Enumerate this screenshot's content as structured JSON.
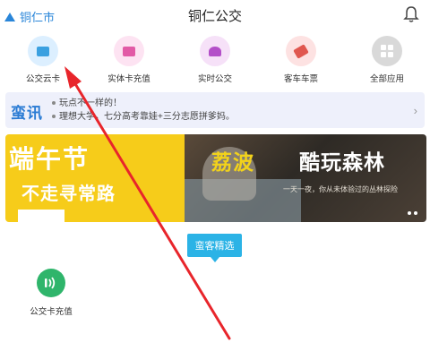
{
  "header": {
    "location": "铜仁市",
    "title": "铜仁公交"
  },
  "grid": [
    {
      "label": "公交云卡",
      "icon": "bus-card-icon",
      "bg": "#dcefff",
      "fg": "#3aa0e0"
    },
    {
      "label": "实体卡充值",
      "icon": "card-recharge-icon",
      "bg": "#fde3f2",
      "fg": "#e25aa6"
    },
    {
      "label": "实时公交",
      "icon": "realtime-bus-icon",
      "bg": "#f6e1f8",
      "fg": "#b34fc8"
    },
    {
      "label": "客车车票",
      "icon": "coach-ticket-icon",
      "bg": "#fde2e2",
      "fg": "#e0574f"
    },
    {
      "label": "全部应用",
      "icon": "all-apps-icon",
      "bg": "#e3e3e3",
      "fg": "#ffffff"
    }
  ],
  "news": {
    "logo": "蛮讯",
    "line1": "玩点不一样的！",
    "line2": "理想大学，七分高考靠娃+三分志愿拼爹妈。"
  },
  "banner": {
    "left_title": "端午节",
    "left_sub": "不走寻常路",
    "right_title_a": "荔波",
    "right_title_b": "酷玩森林",
    "right_sub": "一天一夜，你从未体验过的丛林探险"
  },
  "tabs": {
    "selected": "蛮客精选"
  },
  "service": {
    "label": "公交卡充值"
  },
  "colors": {
    "accent": "#2bb3e6",
    "annotation_arrow": "#e8252b"
  }
}
